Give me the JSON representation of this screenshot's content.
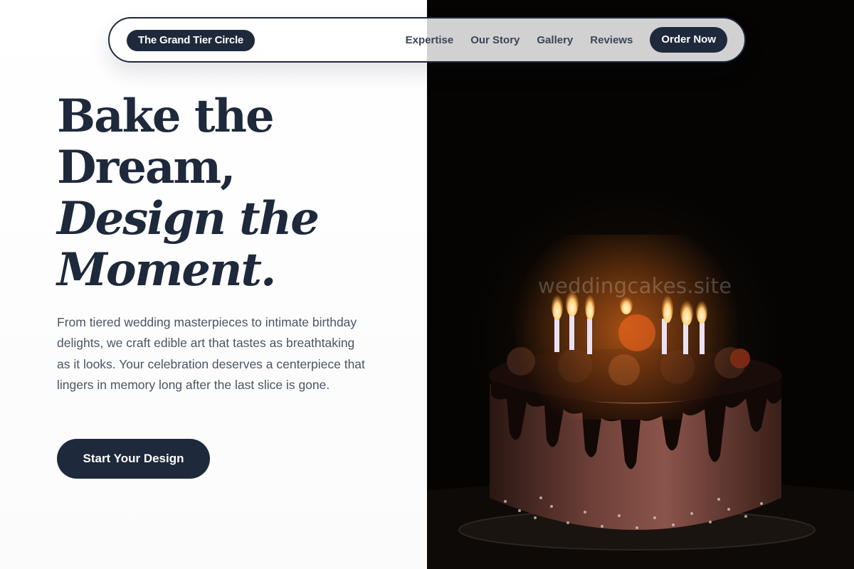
{
  "navbar": {
    "brand": "The Grand Tier Circle",
    "links": [
      "Expertise",
      "Our Story",
      "Gallery",
      "Reviews"
    ],
    "cta": "Order Now"
  },
  "hero": {
    "headline_lines": [
      "Bake the",
      "Dream,",
      "Design the",
      "Moment."
    ],
    "description": "From tiered wedding masterpieces to intimate birthday delights, we craft edible art that tastes as breathtaking as it looks. Your celebration deserves a centerpiece that lingers in memory long after the last slice is gone.",
    "button_label": "Start Your Design"
  },
  "image": {
    "watermark": "weddingcakes.site"
  },
  "colors": {
    "primary": "#1e293b",
    "text_muted": "#4b5563",
    "background": "#ffffff",
    "photo_bg": "#050403"
  }
}
